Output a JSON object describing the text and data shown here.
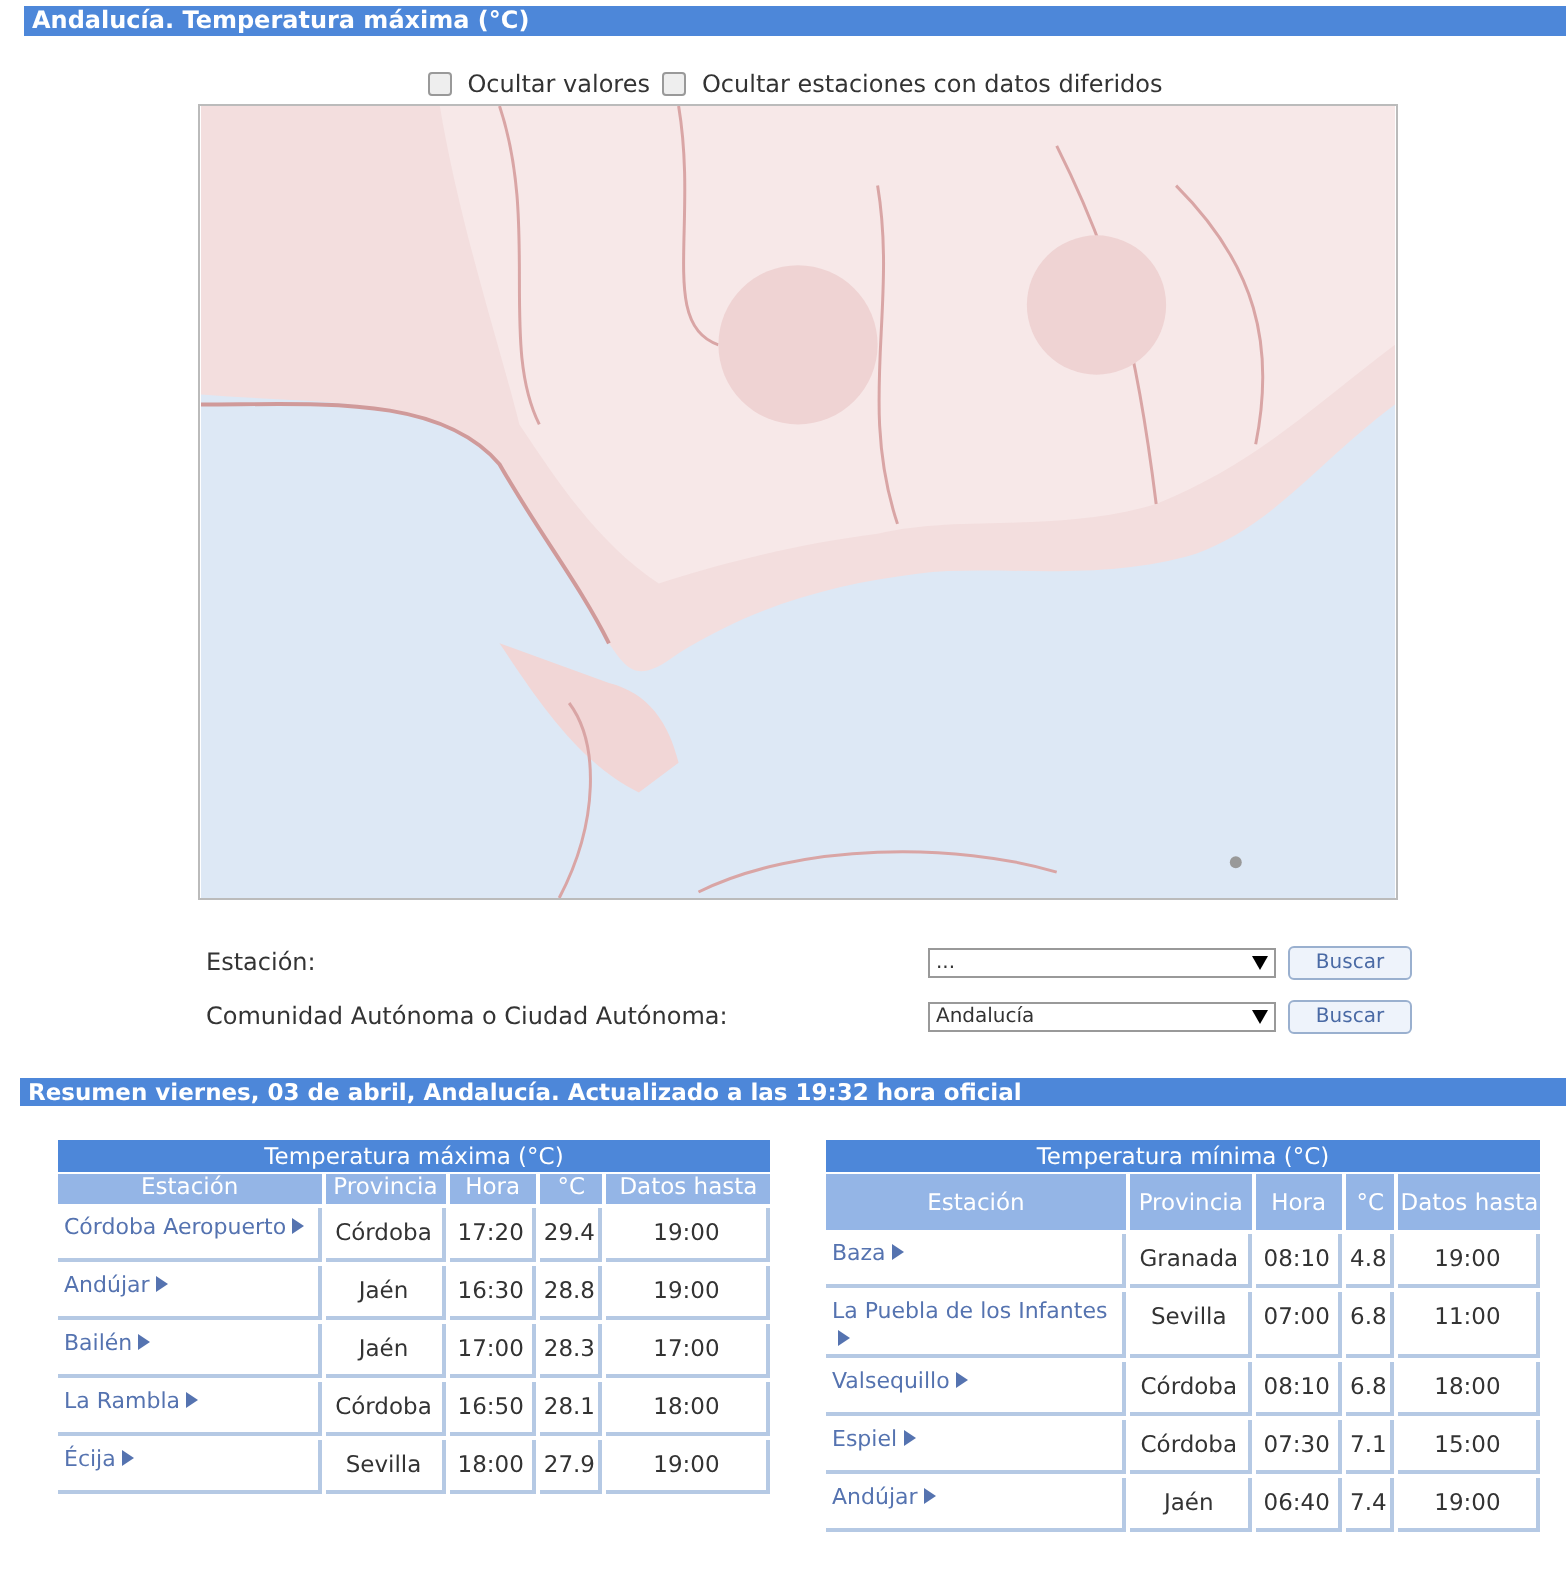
{
  "header": {
    "title": "Andalucía. Temperatura máxima (°C)"
  },
  "options": [
    {
      "label": "Ocultar valores",
      "checked": false
    },
    {
      "label": "Ocultar estaciones con datos diferidos",
      "checked": false
    }
  ],
  "filters": [
    {
      "label": "Estación:",
      "value": "...",
      "button": "Buscar"
    },
    {
      "label": "Comunidad Autónoma o Ciudad Autónoma:",
      "value": "Andalucía",
      "button": "Buscar"
    }
  ],
  "summary_bar": {
    "title": "Resumen viernes, 03 de abril, Andalucía. Actualizado a las 19:32 hora oficial"
  },
  "tables": [
    {
      "title": "Temperatura máxima (°C)",
      "columns": [
        "Estación",
        "Provincia",
        "Hora",
        "°C",
        "Datos hasta"
      ],
      "rows": [
        [
          "Córdoba Aeropuerto",
          "Córdoba",
          "17:20",
          "29.4",
          "19:00"
        ],
        [
          "Andújar",
          "Jaén",
          "16:30",
          "28.8",
          "19:00"
        ],
        [
          "Bailén",
          "Jaén",
          "17:00",
          "28.3",
          "17:00"
        ],
        [
          "La Rambla",
          "Córdoba",
          "16:50",
          "28.1",
          "18:00"
        ],
        [
          "Écija",
          "Sevilla",
          "18:00",
          "27.9",
          "19:00"
        ]
      ]
    },
    {
      "title": "Temperatura mínima (°C)",
      "columns": [
        "Estación",
        "Provincia",
        "Hora",
        "°C",
        "Datos hasta"
      ],
      "rows": [
        [
          "Baza",
          "Granada",
          "08:10",
          "4.8",
          "19:00"
        ],
        [
          "La Puebla de los Infantes",
          "Sevilla",
          "07:00",
          "6.8",
          "11:00"
        ],
        [
          "Valsequillo",
          "Córdoba",
          "08:10",
          "6.8",
          "18:00"
        ],
        [
          "Espiel",
          "Córdoba",
          "07:30",
          "7.1",
          "15:00"
        ],
        [
          "Andújar",
          "Jaén",
          "06:40",
          "7.4",
          "19:00"
        ]
      ]
    }
  ]
}
